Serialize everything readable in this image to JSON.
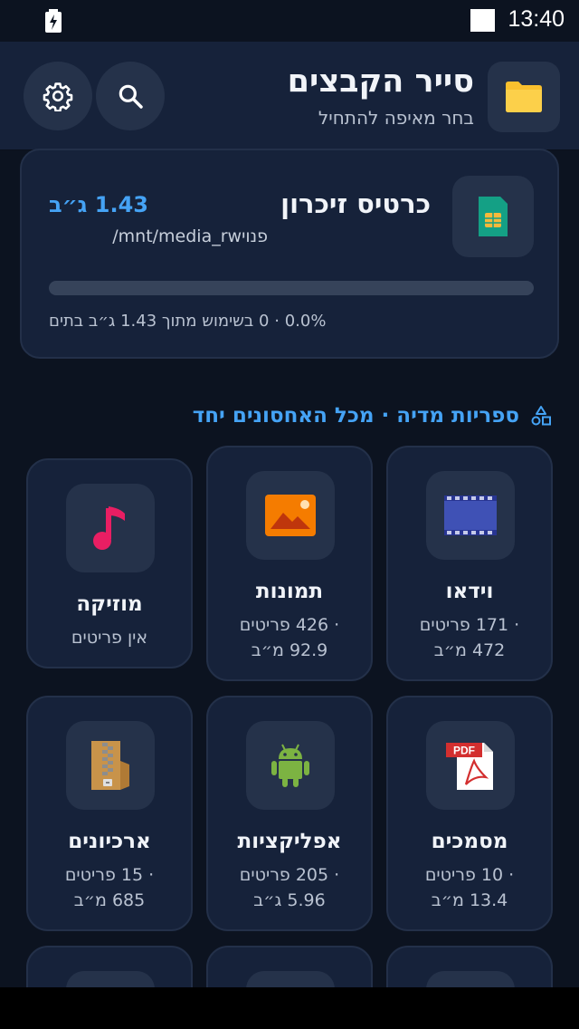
{
  "status_bar": {
    "time": "13:40"
  },
  "app_bar": {
    "title": "סייר הקבצים",
    "subtitle": "בחר מאיפה להתחיל",
    "icons": {
      "folder": "folder-icon",
      "search": "search-icon",
      "settings": "gear-icon"
    }
  },
  "storage": {
    "name": "כרטיס זיכרון",
    "free": "1.43 ג״ב",
    "path": "/mnt/media_rw",
    "path_suffix": "פנוי",
    "used_fraction": 0.0,
    "usage_text": "0 בשימוש מתוך 1.43 ג״ב בתים",
    "separator": "·",
    "percent": "0.0%",
    "icon": "sd-card-icon"
  },
  "section": {
    "title": "ספריות מדיה · מכל האחסונים יחד",
    "icon": "shapes-icon"
  },
  "tiles": [
    {
      "title": "וידאו",
      "count": "· 171 פריטים",
      "size": "472 מ״ב",
      "icon": "video-icon"
    },
    {
      "title": "תמונות",
      "count": "· 426 פריטים",
      "size": "92.9 מ״ב",
      "icon": "image-icon"
    },
    {
      "title": "מוזיקה",
      "count": "אין פריטים",
      "size": "",
      "icon": "music-icon"
    },
    {
      "title": "מסמכים",
      "count": "· 10 פריטים",
      "size": "13.4 מ״ב",
      "icon": "pdf-icon"
    },
    {
      "title": "אפליקציות",
      "count": "· 205 פריטים",
      "size": "5.96 ג״ב",
      "icon": "android-icon"
    },
    {
      "title": "ארכיונים",
      "count": "· 15 פריטים",
      "size": "685 מ״ב",
      "icon": "archive-icon"
    }
  ],
  "colors": {
    "accent": "#45a3f5",
    "background": "#0c1320",
    "card": "#16223a",
    "tile_icon_bg": "#25324a"
  }
}
